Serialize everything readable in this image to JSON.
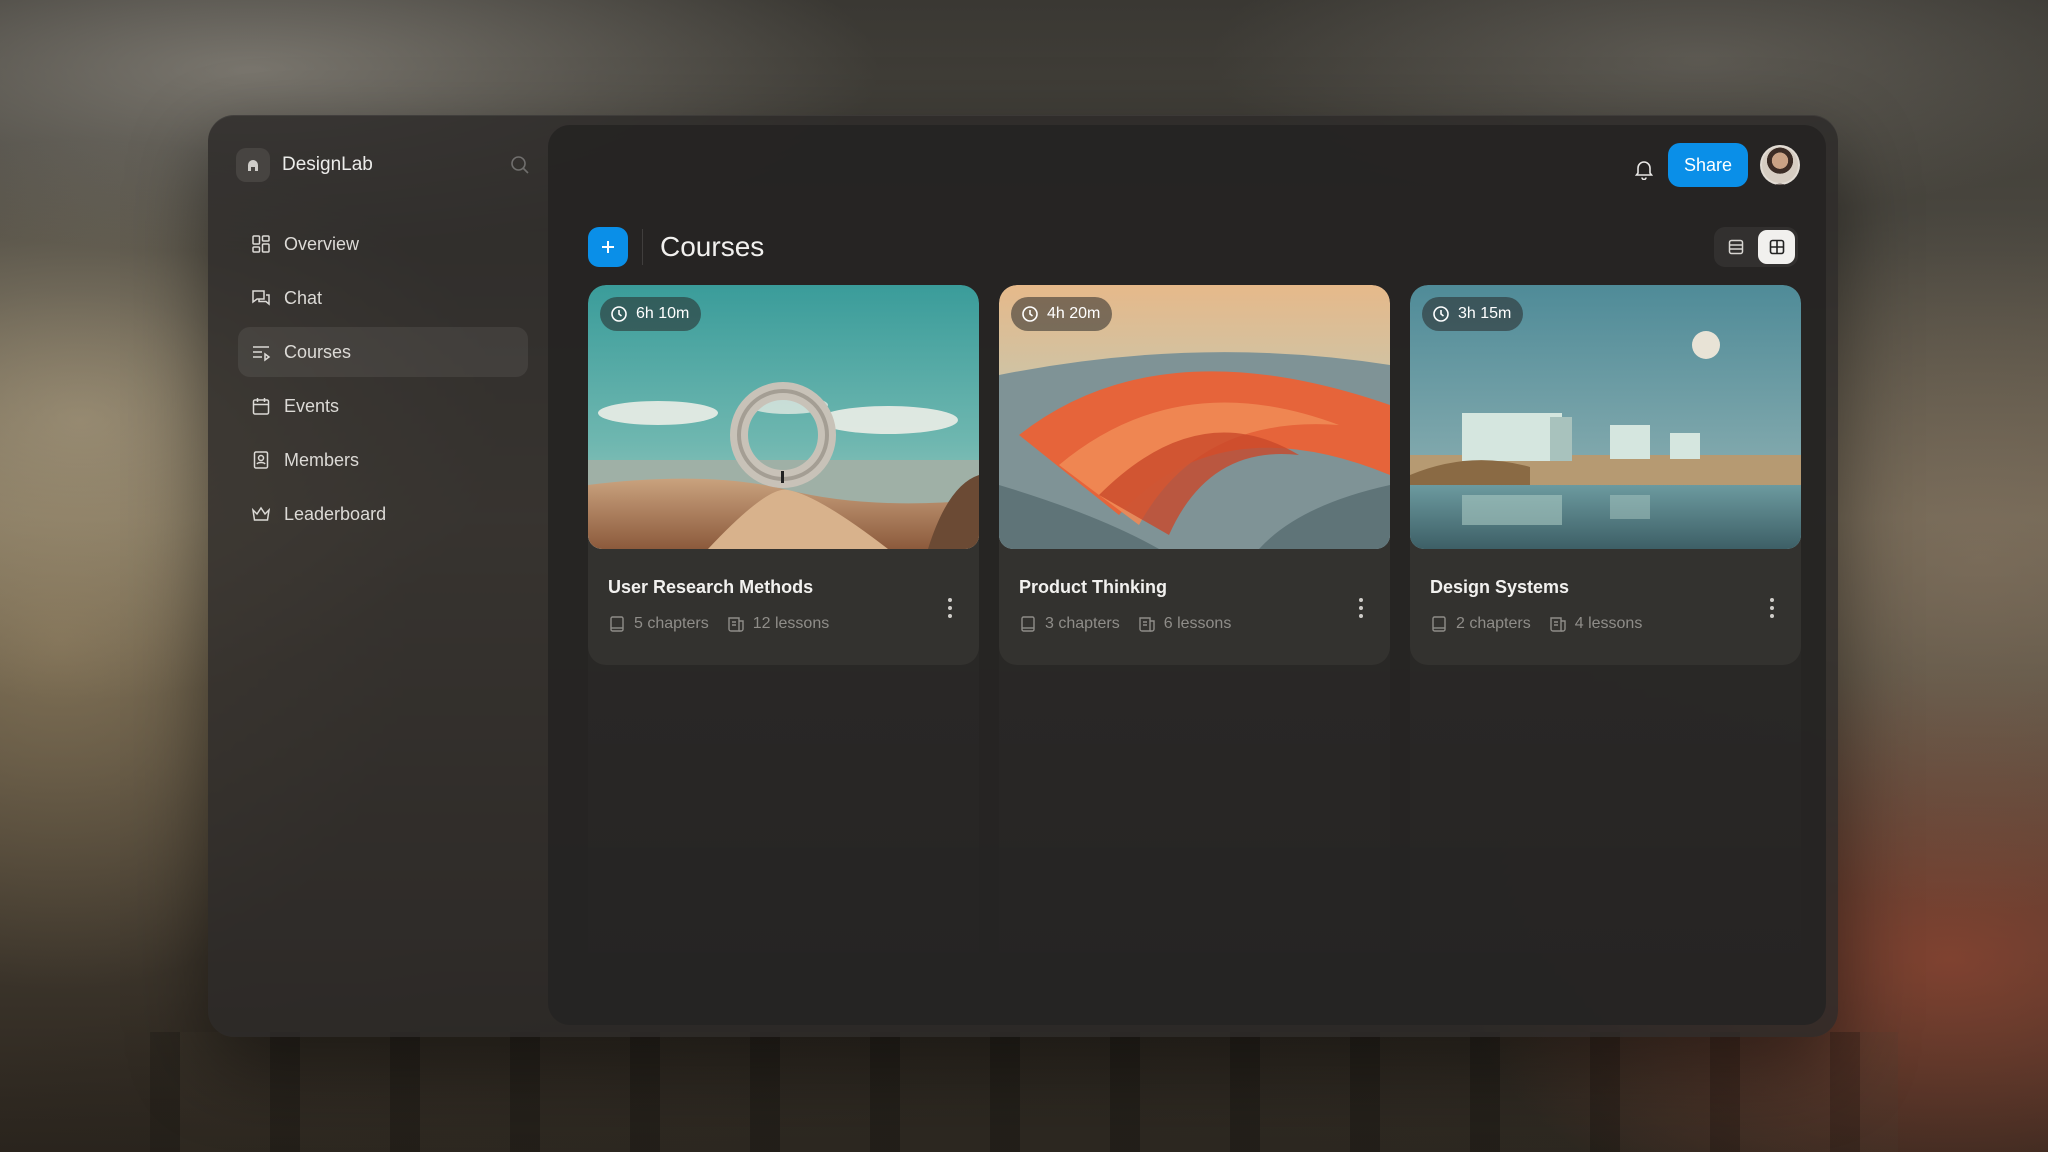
{
  "app": {
    "name": "DesignLab"
  },
  "sidebar": {
    "items": [
      {
        "label": "Overview",
        "icon": "dashboard-icon"
      },
      {
        "label": "Chat",
        "icon": "chat-icon"
      },
      {
        "label": "Courses",
        "icon": "courses-list-icon",
        "active": true
      },
      {
        "label": "Events",
        "icon": "calendar-icon"
      },
      {
        "label": "Members",
        "icon": "member-badge-icon"
      },
      {
        "label": "Leaderboard",
        "icon": "crown-icon"
      }
    ]
  },
  "header": {
    "share_label": "Share"
  },
  "main": {
    "title": "Courses",
    "view_mode": "grid"
  },
  "courses": [
    {
      "duration": "6h 10m",
      "title": "User Research Methods",
      "chapters": "5 chapters",
      "lessons": "12 lessons"
    },
    {
      "duration": "4h 20m",
      "title": "Product Thinking",
      "chapters": "3 chapters",
      "lessons": "6 lessons"
    },
    {
      "duration": "3h 15m",
      "title": "Design Systems",
      "chapters": "2 chapters",
      "lessons": "4 lessons"
    }
  ],
  "colors": {
    "accent": "#0a8fe8",
    "panel": "#252423",
    "card": "#33322f"
  }
}
